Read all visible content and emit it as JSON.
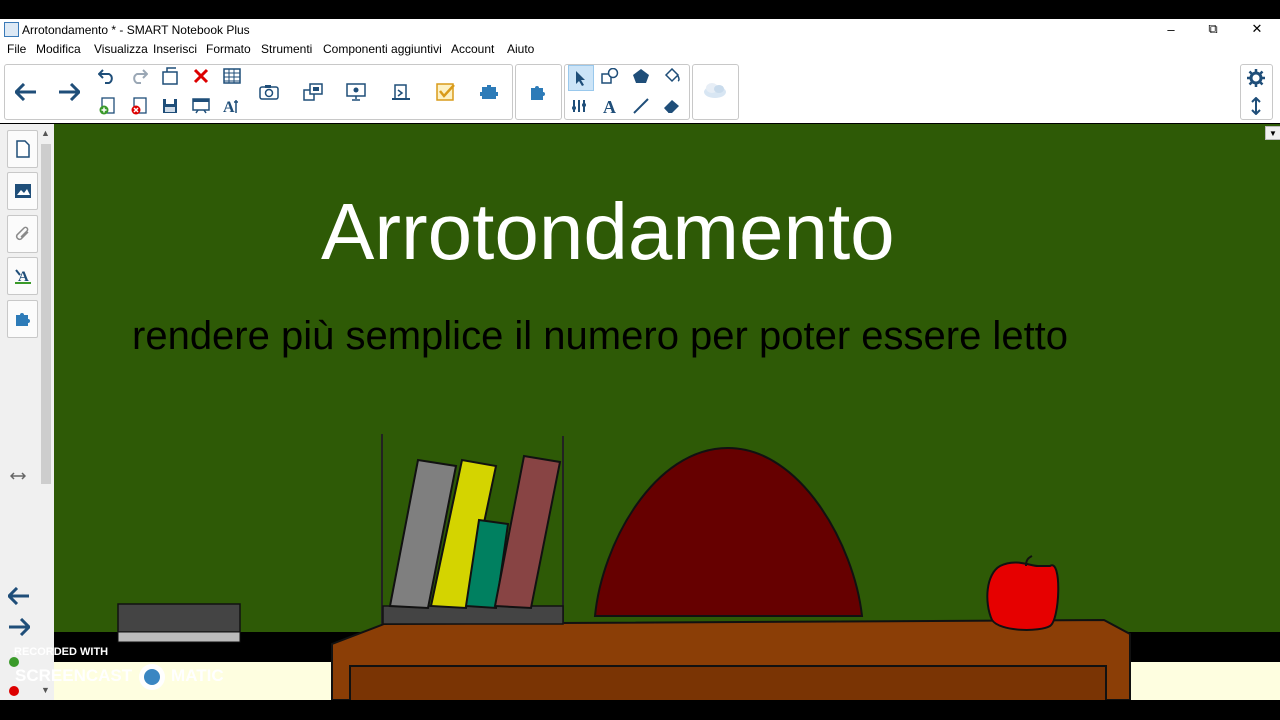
{
  "window": {
    "title": "Arrotondamento * - SMART Notebook Plus",
    "controls": {
      "minimize": "–",
      "restore": "⧉",
      "close": "✕"
    }
  },
  "menu": [
    "File",
    "Modifica",
    "Visualizza",
    "Inserisci",
    "Formato",
    "Strumenti",
    "Componenti aggiuntivi",
    "Account",
    "Aiuto"
  ],
  "toolbar": {
    "icons": [
      "back-arrow",
      "forward-arrow",
      "undo",
      "redo",
      "new-page",
      "delete",
      "table",
      "add-page",
      "delete-page",
      "save",
      "screen-shade",
      "properties-text",
      "screen-capture",
      "document-camera",
      "display",
      "paste-page",
      "checklist",
      "response-addon",
      "addon-puzzle",
      "select",
      "shapes",
      "fill",
      "pen",
      "lines",
      "text",
      "line",
      "eraser",
      "magic-cloud",
      "settings",
      "move-toolbar"
    ]
  },
  "sidebar": {
    "tabs": [
      "page-sorter",
      "gallery",
      "attachments",
      "properties",
      "addons"
    ],
    "nav_icons": [
      "expand-arrows",
      "previous-page",
      "next-page"
    ]
  },
  "page": {
    "heading": "Arrotondamento",
    "subtitle": "rendere più semplice il numero per poter essere letto"
  },
  "colors": {
    "chalkboard": "#2e5a06",
    "floor": "#fefee0",
    "desk": "#8b3e06",
    "dome": "#660000",
    "apple": "#e60000",
    "book_gray": "#7f7f7f",
    "book_yellow": "#d4d400",
    "book_teal": "#008060",
    "book_red": "#884444"
  },
  "watermark": {
    "line1": "RECORDED WITH",
    "line2": "SCREENCAST",
    "line3": "MATIC"
  }
}
